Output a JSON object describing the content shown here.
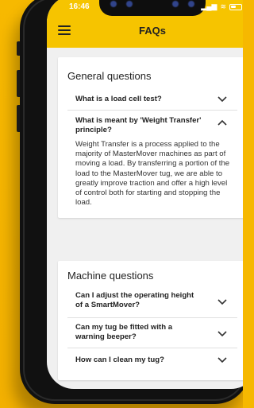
{
  "status_bar": {
    "time": "16:46",
    "signal": "▂▄▆",
    "wifi": "≋"
  },
  "app_bar": {
    "title": "FAQs"
  },
  "sections": [
    {
      "title": "General questions",
      "items": [
        {
          "question": "What is a load cell test?",
          "expanded": false
        },
        {
          "question": "What is meant by 'Weight Transfer' principle?",
          "expanded": true,
          "answer": "Weight Transfer is a process applied to the majority of MasterMover machines as part of moving a load. By transferring a portion of the load to the MasterMover tug, we are able to greatly improve traction and offer a high level of control both for starting and stopping the load."
        }
      ]
    },
    {
      "title": "Machine questions",
      "items": [
        {
          "question": "Can I adjust the operating height of a SmartMover?",
          "expanded": false
        },
        {
          "question": "Can my tug be fitted with a warning beeper?",
          "expanded": false
        },
        {
          "question": "How can I clean my tug?",
          "expanded": false
        }
      ]
    }
  ],
  "colors": {
    "background": "#f6b800",
    "app_bar": "#f6c400",
    "screen_bg": "#f0f0f0",
    "card_bg": "#ffffff"
  }
}
